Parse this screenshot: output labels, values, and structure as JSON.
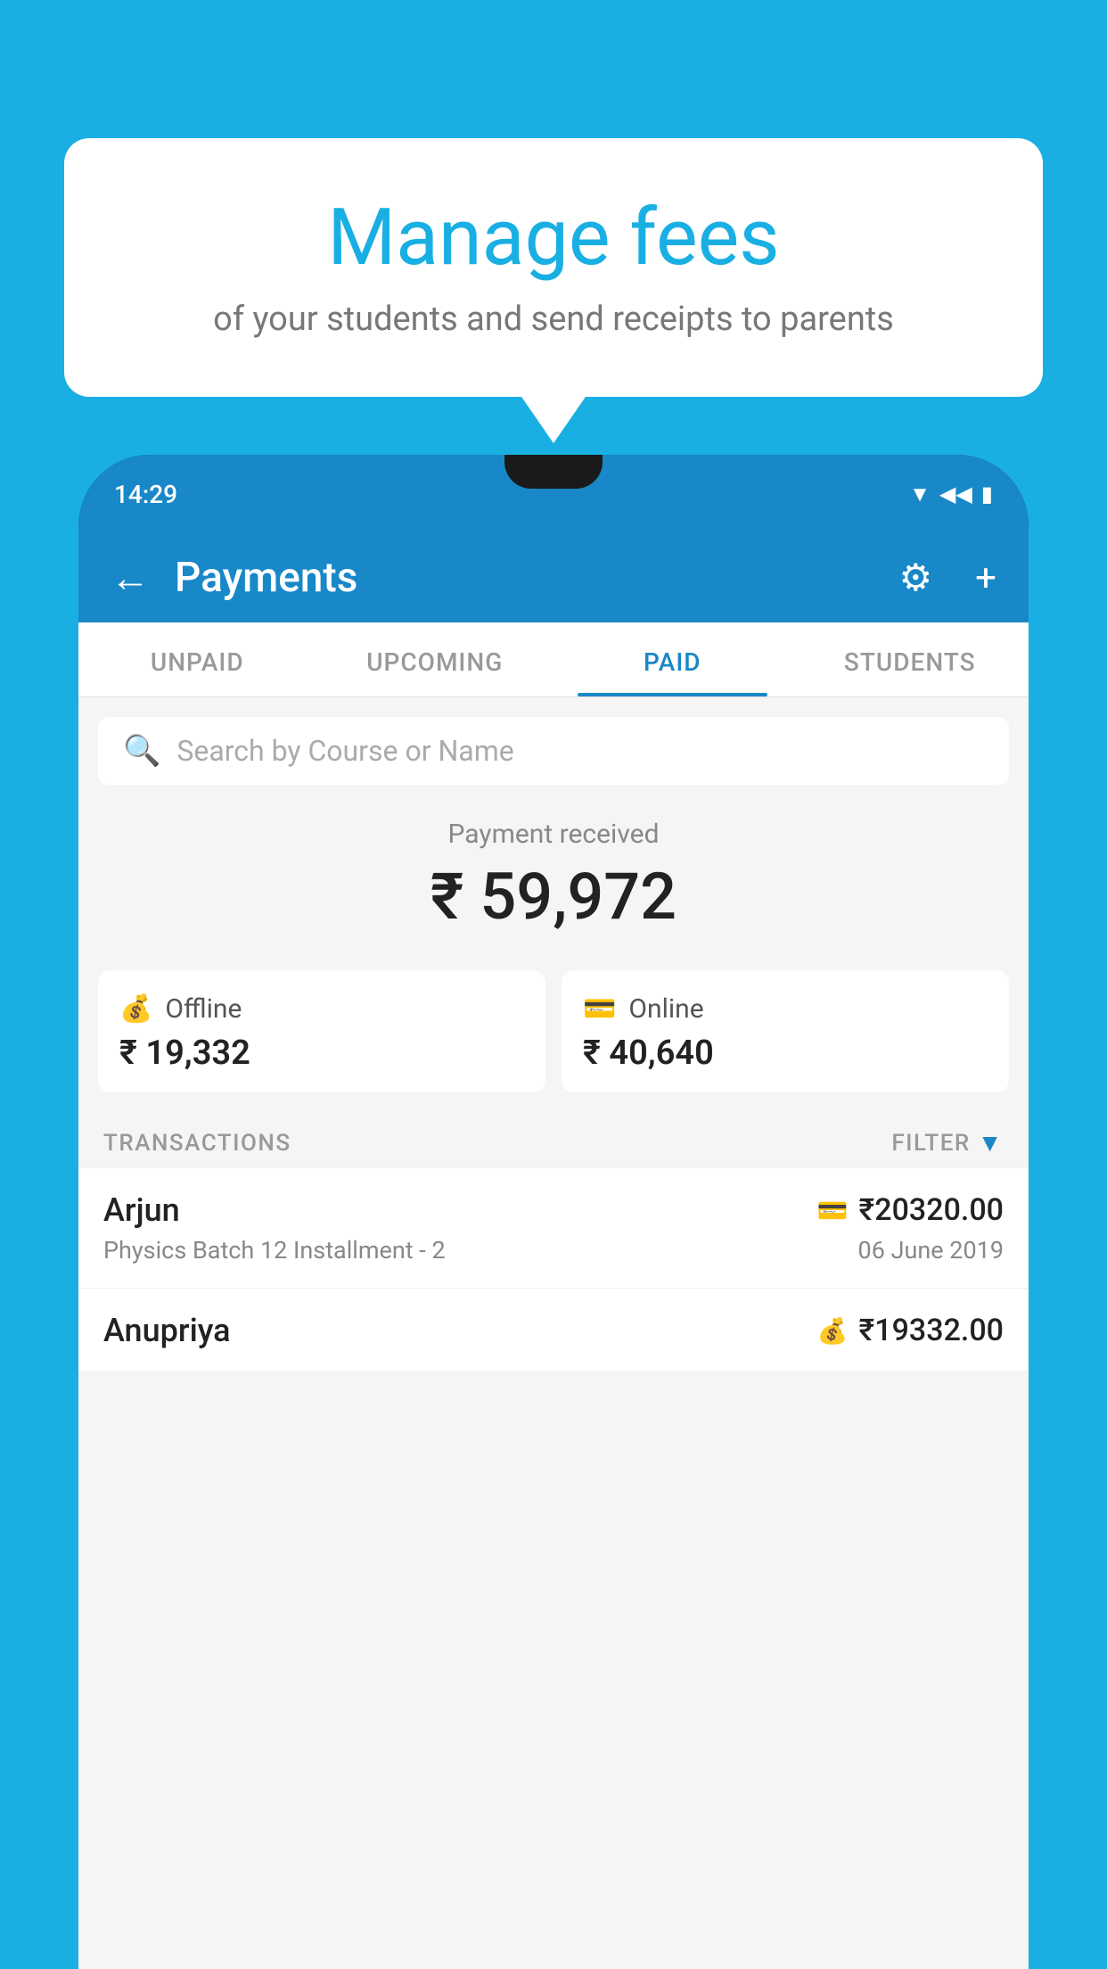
{
  "background_color": "#1AAFE3",
  "speech_bubble": {
    "heading": "Manage fees",
    "subtext": "of your students and send receipts to parents"
  },
  "status_bar": {
    "time": "14:29",
    "wifi_icon": "▲",
    "signal_icon": "▲",
    "battery_icon": "▮"
  },
  "app_header": {
    "title": "Payments",
    "back_label": "←",
    "settings_icon": "⚙",
    "add_icon": "+"
  },
  "tabs": [
    {
      "label": "UNPAID",
      "active": false
    },
    {
      "label": "UPCOMING",
      "active": false
    },
    {
      "label": "PAID",
      "active": true
    },
    {
      "label": "STUDENTS",
      "active": false
    }
  ],
  "search": {
    "placeholder": "Search by Course or Name"
  },
  "payment_received": {
    "label": "Payment received",
    "amount": "₹ 59,972"
  },
  "cards": [
    {
      "type": "Offline",
      "amount": "₹ 19,332",
      "icon": "offline"
    },
    {
      "type": "Online",
      "amount": "₹ 40,640",
      "icon": "online"
    }
  ],
  "transactions_section": {
    "label": "TRANSACTIONS",
    "filter_label": "FILTER"
  },
  "transactions": [
    {
      "name": "Arjun",
      "course": "Physics Batch 12 Installment - 2",
      "amount": "₹20320.00",
      "date": "06 June 2019",
      "payment_type": "online"
    },
    {
      "name": "Anupriya",
      "course": "",
      "amount": "₹19332.00",
      "date": "",
      "payment_type": "offline"
    }
  ]
}
